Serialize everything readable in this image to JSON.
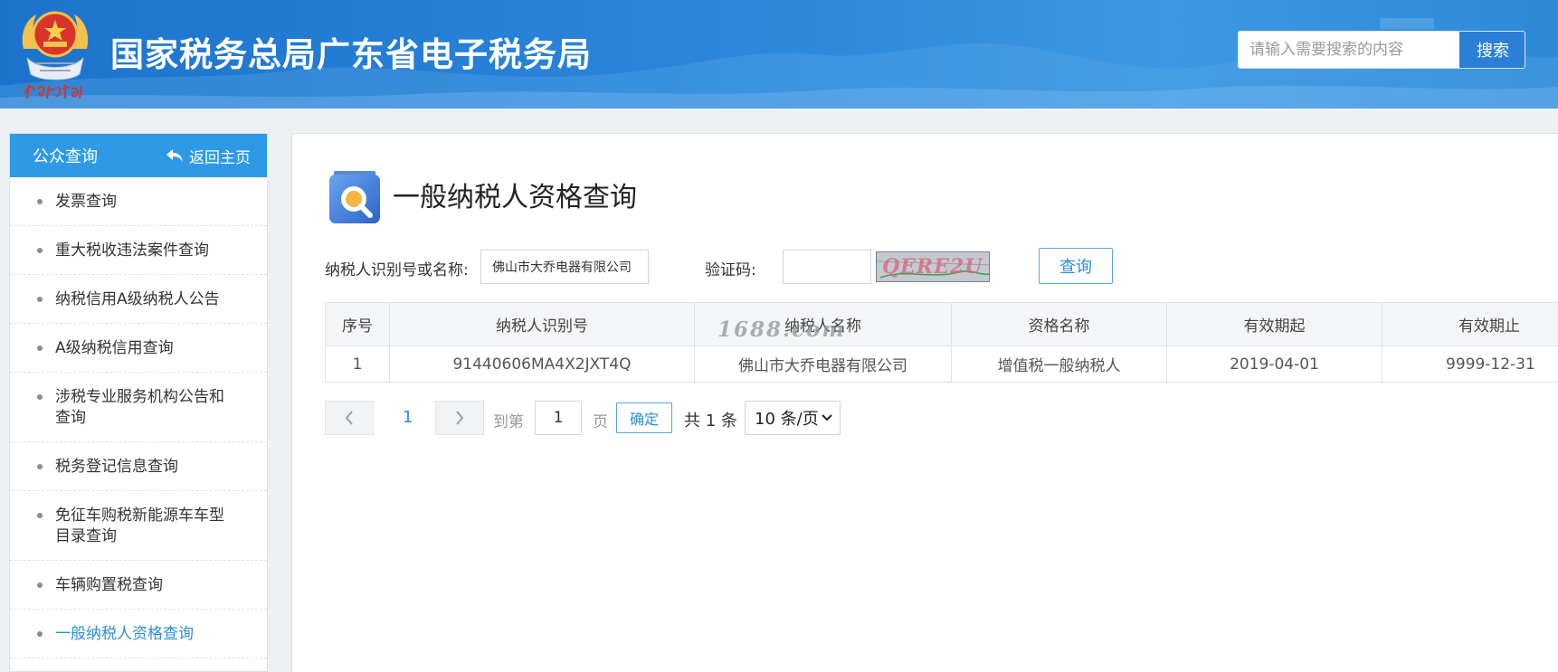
{
  "header": {
    "site_title": "国家税务总局广东省电子税务局",
    "search_placeholder": "请输入需要搜索的内容",
    "search_button": "搜索",
    "brand_color": "#2a86db"
  },
  "sidebar": {
    "title": "公众查询",
    "back_home": "返回主页",
    "items": [
      {
        "label": "发票查询"
      },
      {
        "label": "重大税收违法案件查询"
      },
      {
        "label": "纳税信用A级纳税人公告"
      },
      {
        "label": "A级纳税信用查询"
      },
      {
        "label": "涉税专业服务机构公告和查询"
      },
      {
        "label": "税务登记信息查询"
      },
      {
        "label": "免征车购税新能源车车型目录查询"
      },
      {
        "label": "车辆购置税查询"
      },
      {
        "label": "一般纳税人资格查询",
        "active": true
      }
    ]
  },
  "main": {
    "page_title": "一般纳税人资格查询",
    "form": {
      "taxpayer_label": "纳税人识别号或名称:",
      "taxpayer_value": "佛山市大乔电器有限公司",
      "captcha_label": "验证码:",
      "captcha_value": "",
      "captcha_image_text": "QERE2U",
      "query_button": "查询"
    },
    "table": {
      "headers": [
        "序号",
        "纳税人识别号",
        "纳税人名称",
        "资格名称",
        "有效期起",
        "有效期止"
      ],
      "rows": [
        [
          "1",
          "91440606MA4X2JXT4Q",
          "佛山市大乔电器有限公司",
          "增值税一般纳税人",
          "2019-04-01",
          "9999-12-31"
        ]
      ]
    },
    "watermark": "1688.com",
    "pagination": {
      "current_page": "1",
      "goto_label": "到第",
      "goto_value": "1",
      "page_unit": "页",
      "confirm": "确定",
      "total": "共 1 条",
      "page_size": "10 条/页"
    }
  }
}
